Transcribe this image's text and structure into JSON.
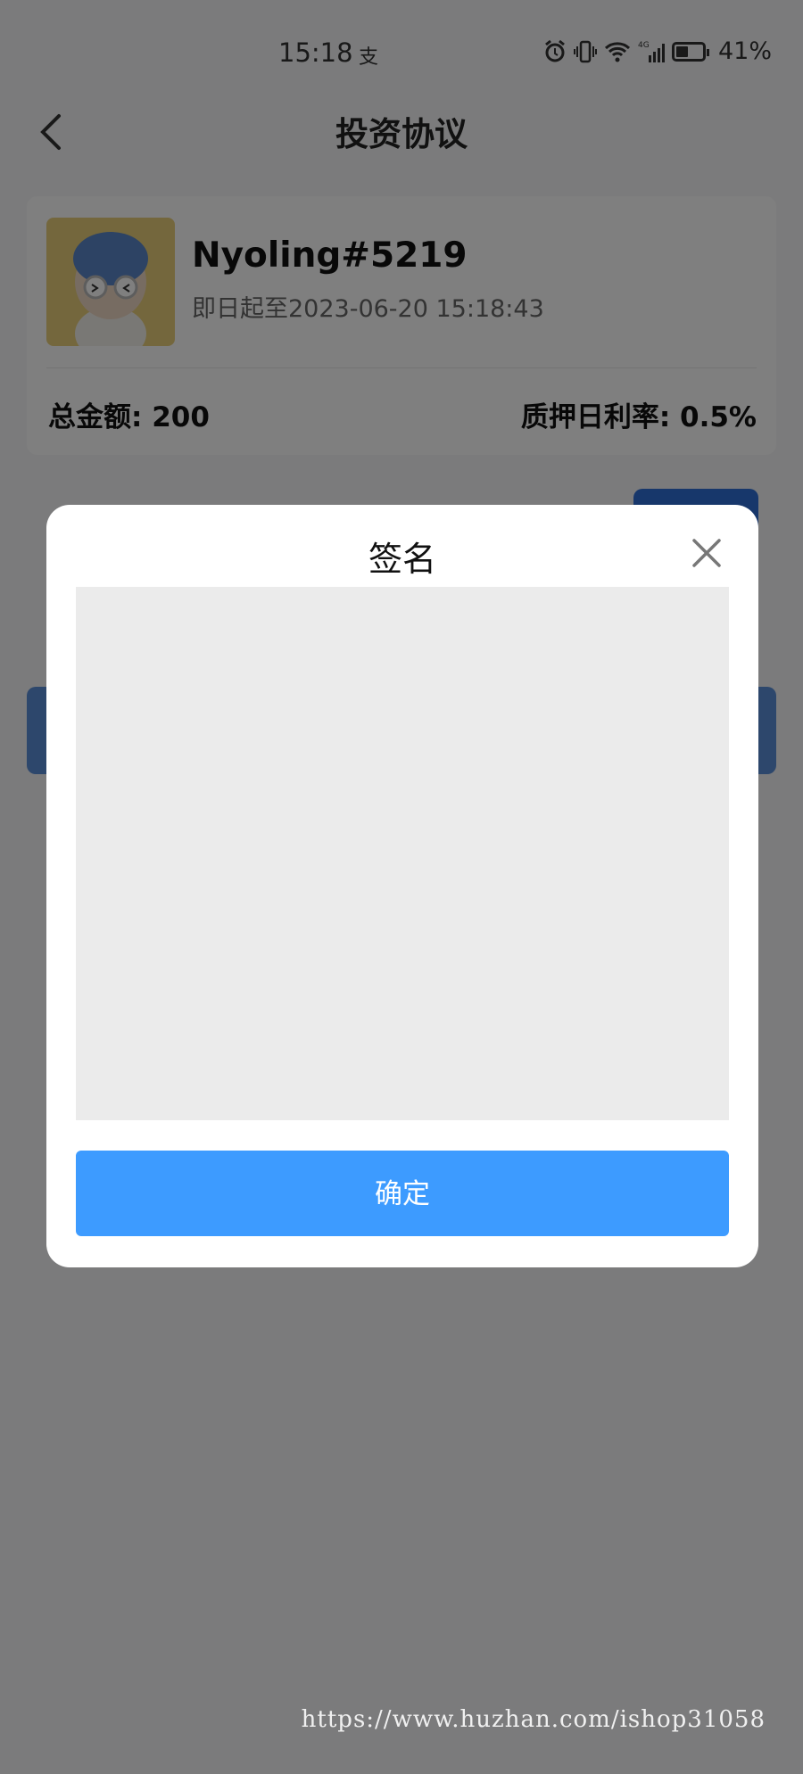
{
  "status_bar": {
    "time": "15:18",
    "time_extra": "支",
    "battery": "41%",
    "battery_level": 0.41,
    "icons": [
      "alarm-icon",
      "vibrate-icon",
      "wifi-icon",
      "signal-4g-icon",
      "battery-icon"
    ]
  },
  "nav": {
    "title": "投资协议",
    "back_icon": "chevron-left-icon"
  },
  "card": {
    "username": "Nyoling#5219",
    "period": "即日起至2023-06-20 15:18:43",
    "total_amount": "总金额: 200",
    "daily_rate": "质押日利率: 0.5%"
  },
  "modal": {
    "title": "签名",
    "confirm_label": "确定",
    "close_icon": "close-icon"
  },
  "watermark": "https://www.huzhan.com/ishop31058",
  "colors": {
    "accent": "#3d9bff",
    "overlay": "rgba(0,0,0,0.5)",
    "pad": "#ebebeb"
  }
}
